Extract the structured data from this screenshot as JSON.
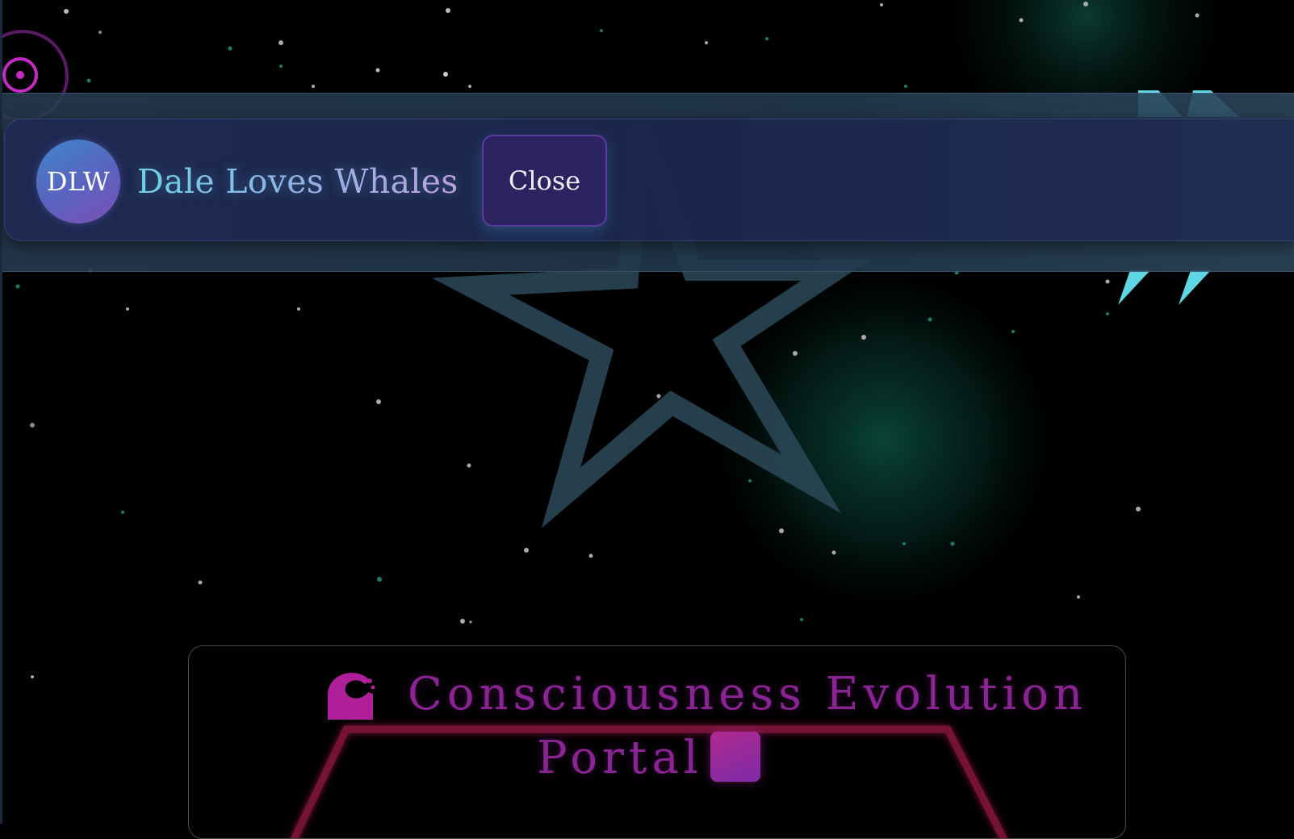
{
  "header": {
    "logo_initials": "DLW",
    "brand_name": "Dale Loves Whales",
    "close_label": "Close"
  },
  "portal": {
    "title_line_1": "Consciousness Evolution",
    "title_line_2": "Portal"
  },
  "colors": {
    "background": "#000000",
    "header_bar": "#1e2a52",
    "close_button_bg": "#2c2361",
    "close_button_border": "#5b3b9c",
    "brand_gradient_start": "#6dd4e6",
    "brand_gradient_end": "#c79de0",
    "portal_title": "#8b2394",
    "portal_glow": "#c2185b",
    "nebula_teal": "#0b4a3e",
    "accent_cyan": "#5fd6e4",
    "accent_magenta": "#c42bc4",
    "star_outline": "#2a4655"
  },
  "icons": {
    "portal_left_icon": "whale-icon",
    "portal_right_icon": "square-icon",
    "top_left_icon": "target-ring-icon",
    "top_right_icon": "mountain-peaks-icon"
  }
}
